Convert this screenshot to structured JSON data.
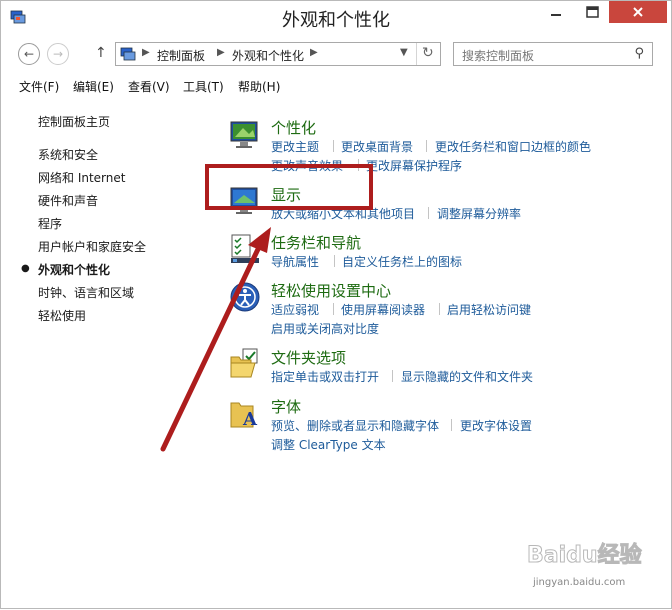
{
  "window": {
    "title": "外观和个性化"
  },
  "address": {
    "segments": [
      "控制面板",
      "外观和个性化"
    ],
    "search_placeholder": "搜索控制面板"
  },
  "menu": [
    "文件(F)",
    "编辑(E)",
    "查看(V)",
    "工具(T)",
    "帮助(H)"
  ],
  "left_nav": {
    "home": "控制面板主页",
    "items": [
      "系统和安全",
      "网络和 Internet",
      "硬件和声音",
      "程序",
      "用户帐户和家庭安全",
      "外观和个性化",
      "时钟、语言和区域",
      "轻松使用"
    ],
    "current_index": 5
  },
  "sections": {
    "personalization": {
      "title": "个性化",
      "links": [
        "更改主题",
        "更改桌面背景",
        "更改任务栏和窗口边框的颜色",
        "更改声音效果",
        "更改屏幕保护程序"
      ]
    },
    "display": {
      "title": "显示",
      "links": [
        "放大或缩小文本和其他项目",
        "调整屏幕分辨率"
      ]
    },
    "taskbar": {
      "title": "任务栏和导航",
      "links": [
        "导航属性",
        "自定义任务栏上的图标"
      ]
    },
    "ease": {
      "title": "轻松使用设置中心",
      "links": [
        "适应弱视",
        "使用屏幕阅读器",
        "启用轻松访问键",
        "启用或关闭高对比度"
      ]
    },
    "folder": {
      "title": "文件夹选项",
      "links": [
        "指定单击或双击打开",
        "显示隐藏的文件和文件夹"
      ]
    },
    "fonts": {
      "title": "字体",
      "links": [
        "预览、删除或者显示和隐藏字体",
        "更改字体设置",
        "调整 ClearType 文本"
      ]
    }
  },
  "watermark": {
    "main": "Baidu经验",
    "sub": "jingyan.baidu.com"
  },
  "colors": {
    "annotation": "#ad1d1d",
    "title_green": "#1e6b12",
    "link_blue": "#1e5b9a",
    "close": "#c9463d"
  }
}
